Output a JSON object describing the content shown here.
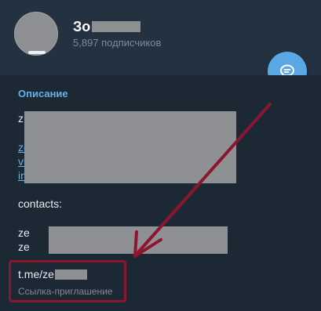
{
  "header": {
    "channel_name_prefix": "Зо",
    "subscribers": "5,897 подписчиков"
  },
  "actions": {
    "message_icon": "message-bubble-icon"
  },
  "description": {
    "label": "Описание",
    "line_1_prefix": "z",
    "link_1_prefix": "ze",
    "link_2_prefix": "vl",
    "link_3_prefix": "in",
    "contacts_label": "contacts:",
    "contact_1_prefix": "ze",
    "contact_2_prefix": "ze"
  },
  "invite": {
    "link_prefix": "t.me/ze",
    "caption": "Ссылка-приглашение"
  },
  "annotation": {
    "color": "#8c1630"
  }
}
